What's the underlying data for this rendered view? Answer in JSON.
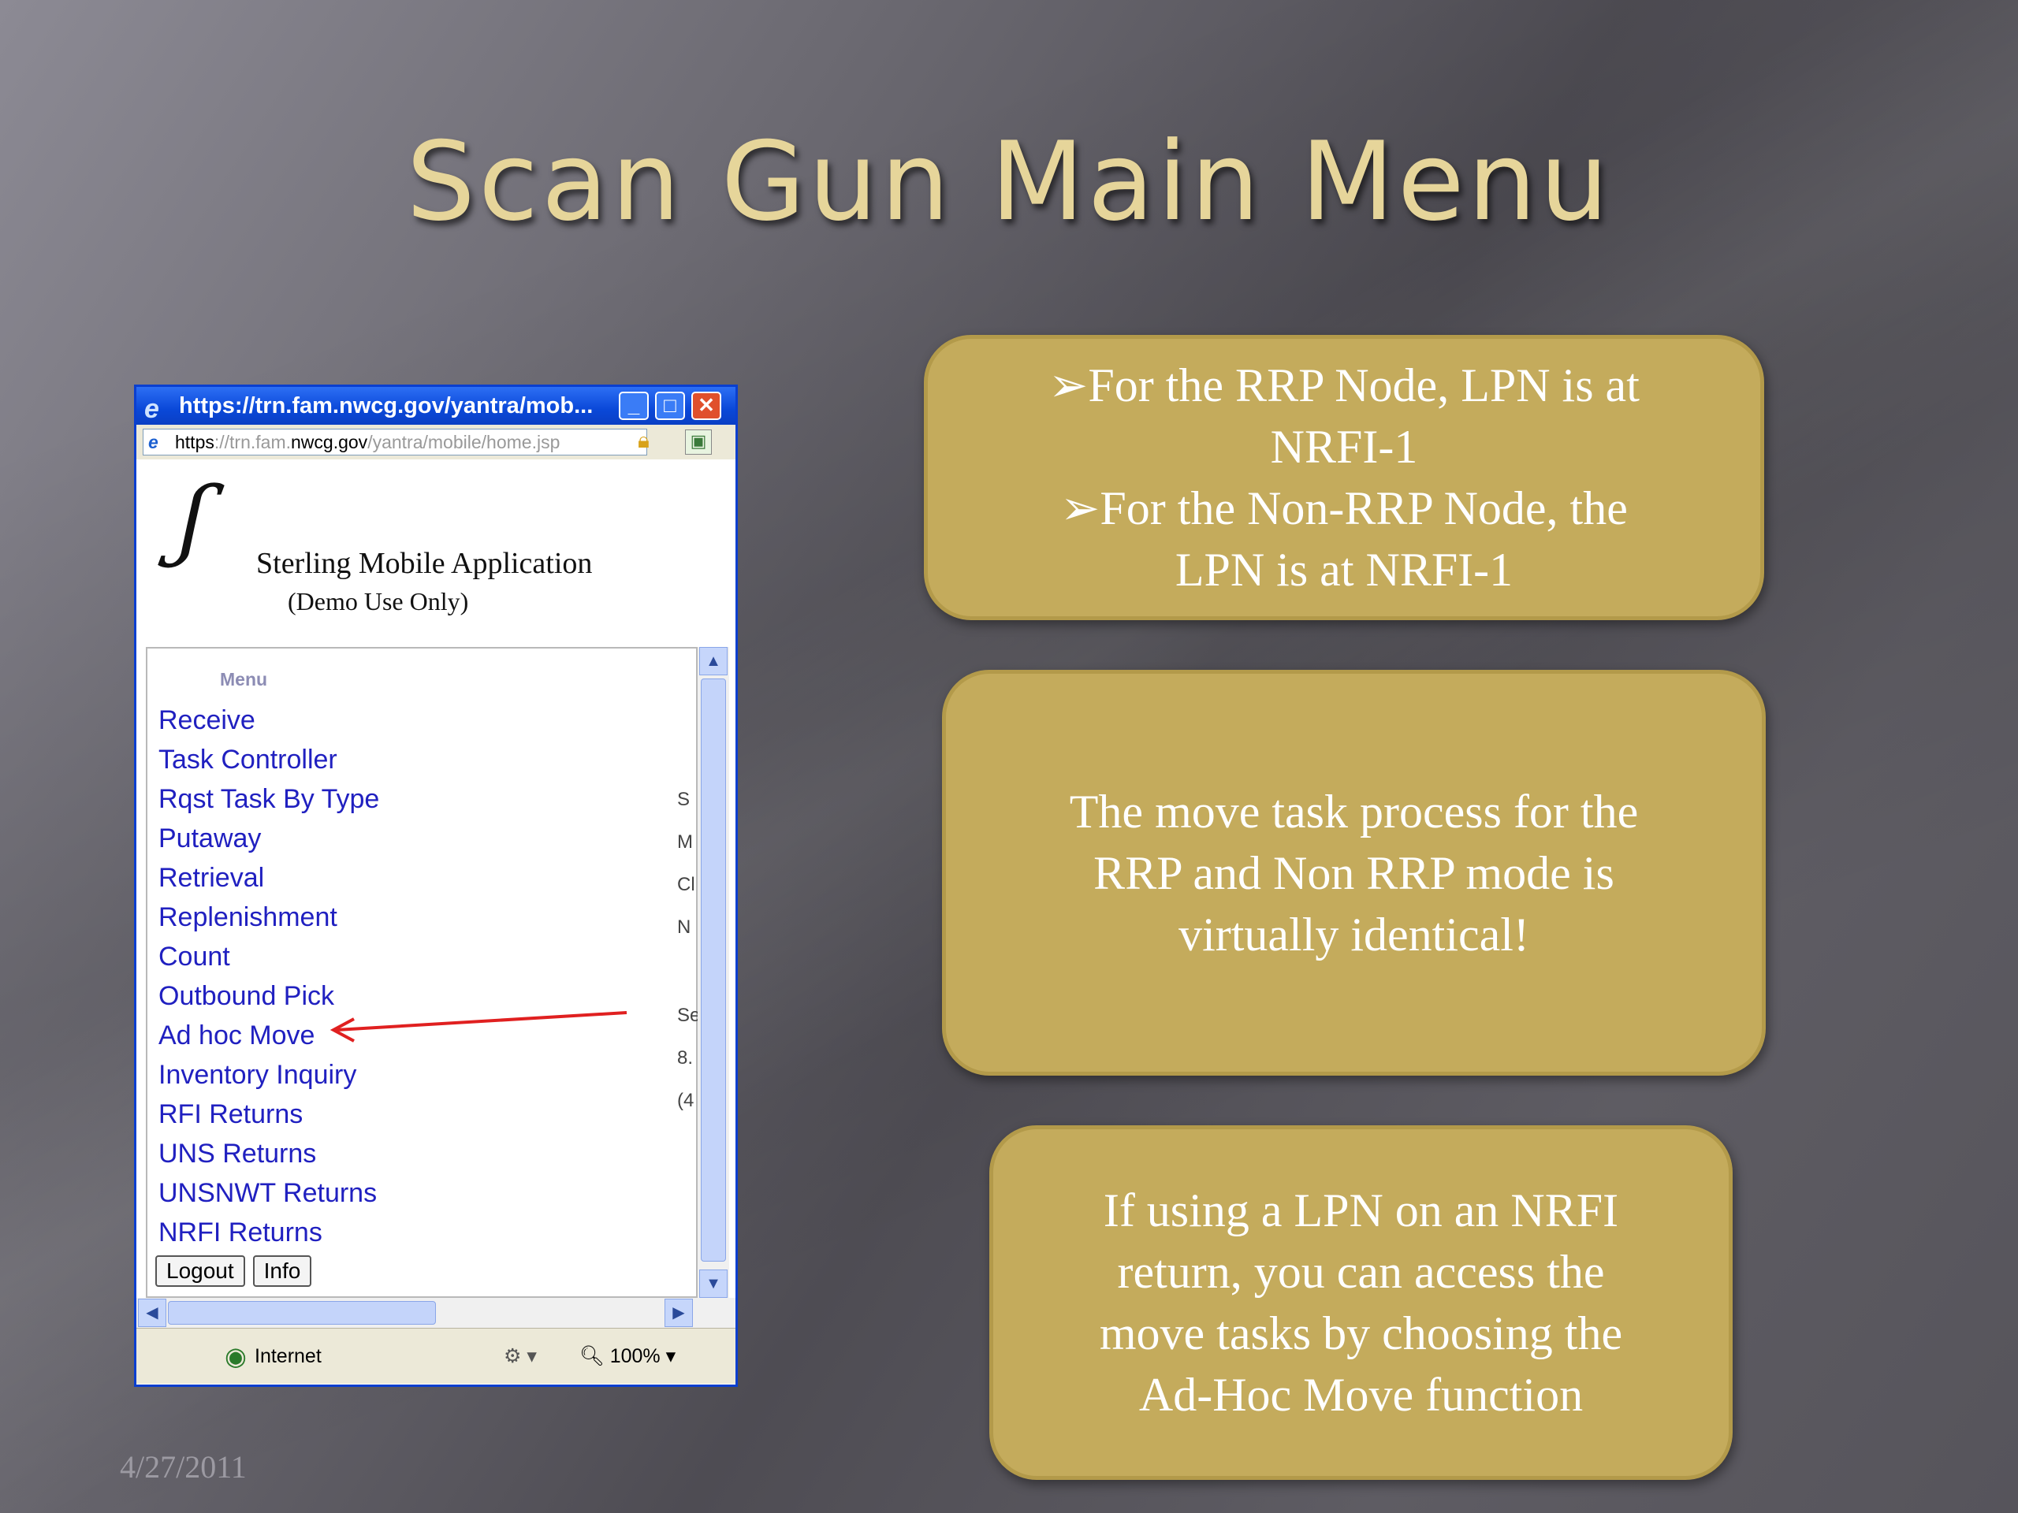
{
  "slide": {
    "title": "Scan Gun Main Menu",
    "date": "4/27/2011"
  },
  "callouts": {
    "box1_lines": [
      "➢For the RRP Node, LPN is at",
      "NRFI-1",
      "➢For the Non-RRP Node, the",
      "LPN is at NRFI-1"
    ],
    "box2_lines": [
      "The move task process for the",
      "RRP and Non RRP mode is",
      "virtually identical!"
    ],
    "box3_lines": [
      "If using a LPN on an NRFI",
      "return, you can access the",
      "move tasks by choosing the",
      "Ad-Hoc Move function"
    ]
  },
  "browser": {
    "window_title": "https://trn.fam.nwcg.gov/yantra/mob...",
    "address": {
      "scheme": "https",
      "sep": "://",
      "host_pre": "trn.fam.",
      "host_main": "nwcg.gov",
      "path": "/yantra/mobile/home.jsp"
    },
    "app_name": "Sterling Mobile Application",
    "app_note": "(Demo Use Only)",
    "menu_heading": "Menu",
    "menu_items": [
      "Receive",
      "Task Controller",
      "Rqst Task By Type",
      "Putaway",
      "Retrieval",
      "Replenishment",
      "Count",
      "Outbound Pick",
      "Ad hoc Move",
      "Inventory Inquiry",
      "RFI Returns",
      "UNS Returns",
      "UNSNWT Returns",
      "NRFI Returns"
    ],
    "buttons": {
      "logout": "Logout",
      "info": "Info"
    },
    "clipped_text": [
      "S",
      "M",
      "Cl",
      "N",
      "Se",
      "8.",
      "(4"
    ],
    "status": {
      "zone": "Internet",
      "zoom": "100%"
    }
  },
  "annotation": {
    "arrow_target": "Ad hoc Move",
    "color": "#e02020"
  },
  "colors": {
    "callout_fill": "#c4ab5c",
    "title": "#e6d59a",
    "link": "#2020c0",
    "xp_blue": "#0a48d8"
  }
}
